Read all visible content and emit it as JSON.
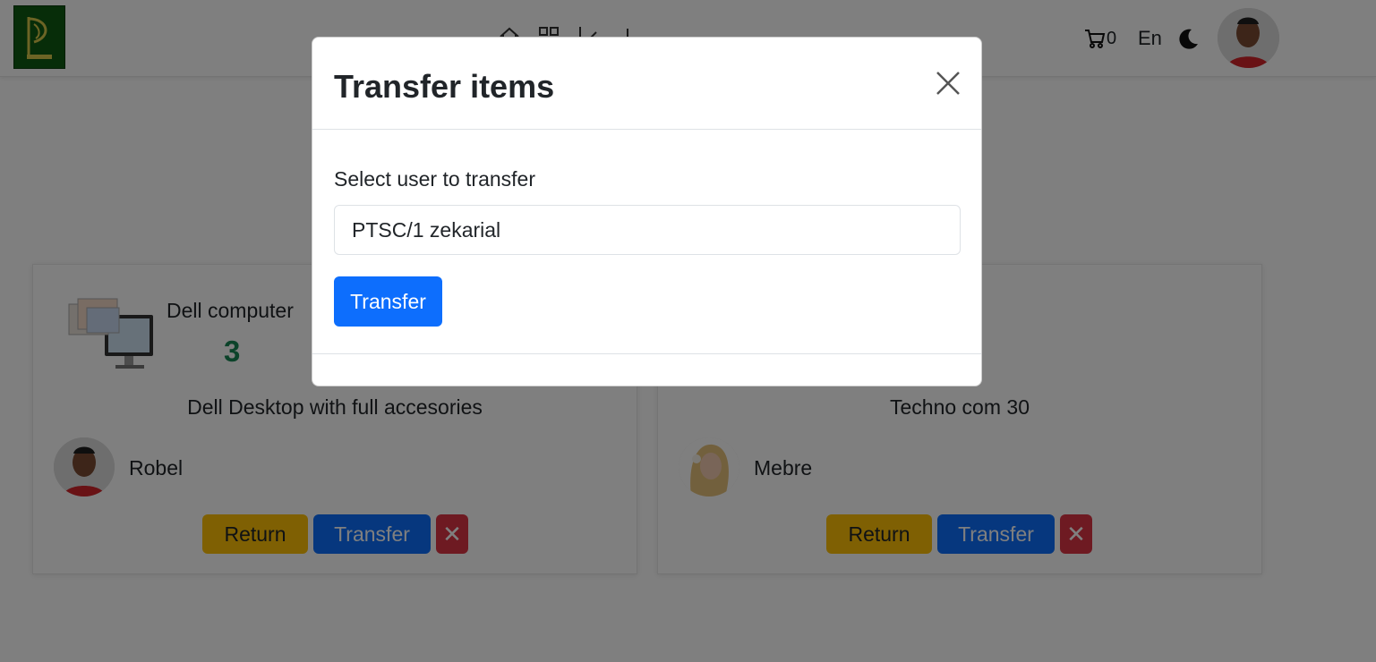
{
  "navbar": {
    "cart_count": "0",
    "language": "En",
    "icons": [
      "home-icon",
      "grid-icon",
      "check-icon",
      "menu-icon",
      "cart-icon",
      "moon-icon"
    ]
  },
  "cards": [
    {
      "product_name": "Dell computer",
      "count": "3",
      "description": "Dell Desktop with full accesories",
      "holder": "Robel",
      "return_label": "Return",
      "transfer_label": "Transfer",
      "delete_label": "✕"
    },
    {
      "product_name": "",
      "count": "",
      "description": "Techno com 30",
      "holder": "Mebre",
      "return_label": "Return",
      "transfer_label": "Transfer",
      "delete_label": "✕"
    }
  ],
  "modal": {
    "title": "Transfer items",
    "label": "Select user to transfer",
    "selected_user": "PTSC/1 zekarial",
    "submit_label": "Transfer"
  },
  "colors": {
    "primary": "#0d6efd",
    "warning": "#ffc107",
    "danger": "#dc3545",
    "success": "#198754",
    "backdrop": "rgba(0,0,0,0.5)"
  }
}
